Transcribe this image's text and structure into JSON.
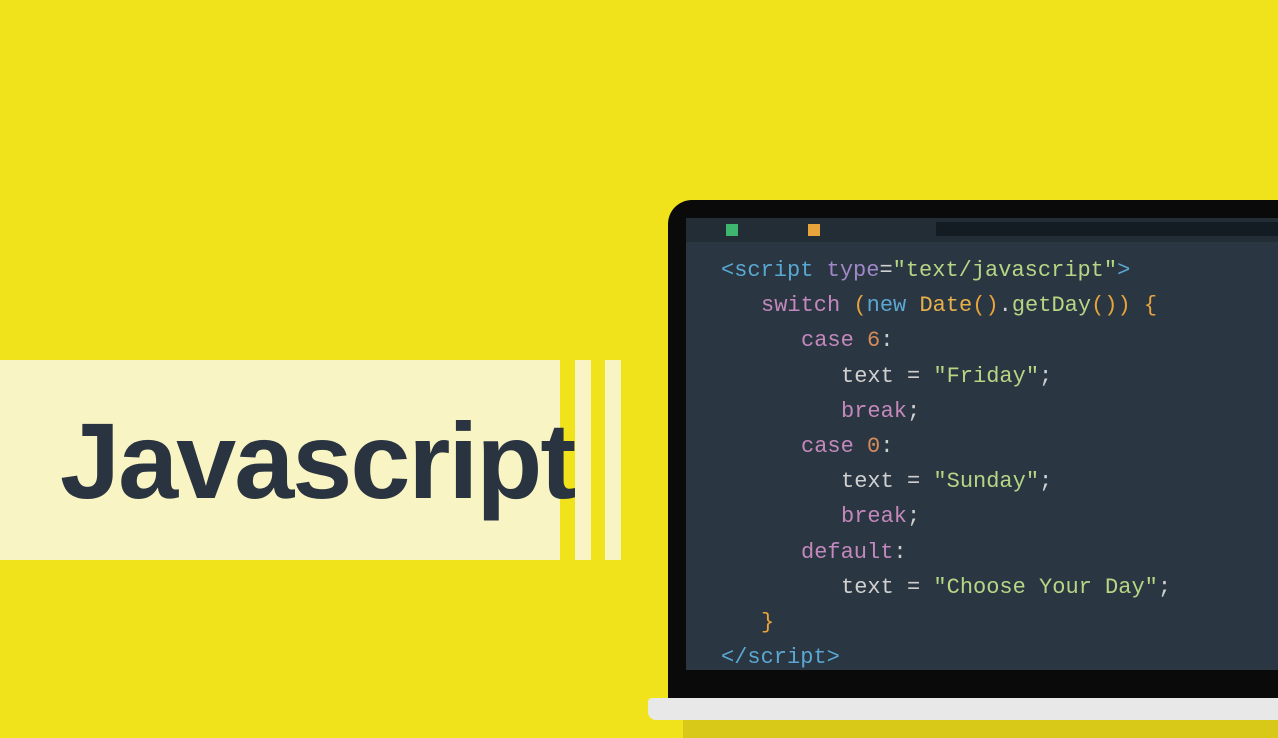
{
  "title": "Javascript",
  "code": {
    "scriptTag": "script",
    "typeAttr": "type",
    "typeValue": "\"text/javascript\"",
    "switchKw": "switch",
    "newKw": "new",
    "dateClass": "Date",
    "getDayMethod": "getDay",
    "caseKw": "case",
    "case1": "6",
    "textIdent": "text",
    "eq": " = ",
    "friday": "\"Friday\"",
    "breakKw": "break",
    "case2": "0",
    "sunday": "\"Sunday\"",
    "defaultKw": "default",
    "choose": "\"Choose Your Day\"",
    "semi": ";",
    "colon": ":",
    "lt": "<",
    "gt": ">",
    "ltSlash": "</",
    "lparen": "(",
    "rparen": ")",
    "lbrace": "{",
    "rbrace": "}",
    "dot": "."
  }
}
